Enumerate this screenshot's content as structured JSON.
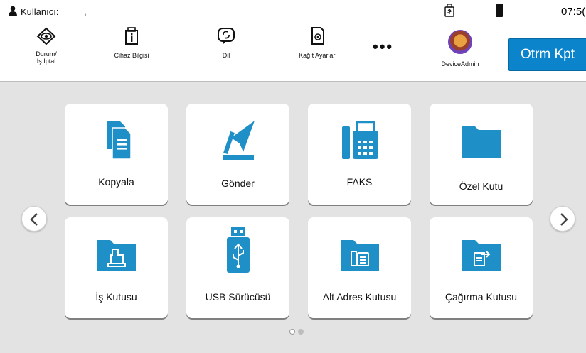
{
  "status_bar": {
    "user_label": "Kullanıcı:",
    "user_value": ",",
    "clock": "07:5("
  },
  "toolbar": {
    "status_cancel_label": "Durum/\nİş İptal",
    "device_info_label": "Cihaz Bilgisi",
    "language_label": "Dil",
    "paper_settings_label": "Kağıt Ayarları",
    "more_label": "•••",
    "account_label": "DeviceAdmin",
    "logout_label": "Otrm Kpt"
  },
  "tiles": [
    {
      "label": "Kopyala",
      "icon": "copy-icon"
    },
    {
      "label": "Gönder",
      "icon": "send-icon"
    },
    {
      "label": "FAKS",
      "icon": "fax-icon"
    },
    {
      "label": "Özel Kutu",
      "icon": "custom-box-folder-icon"
    },
    {
      "label": "İş Kutusu",
      "icon": "job-box-folder-icon"
    },
    {
      "label": "USB Sürücüsü",
      "icon": "usb-drive-icon"
    },
    {
      "label": "Alt Adres Kutusu",
      "icon": "subaddress-box-folder-icon"
    },
    {
      "label": "Çağırma Kutusu",
      "icon": "polling-box-folder-icon"
    }
  ],
  "pagination": {
    "current_page": 1,
    "total_pages": 2
  },
  "colors": {
    "accent": "#0b84cc",
    "icon_blue": "#1f8fc7",
    "background": "#e3e3e3",
    "tile": "#ffffff"
  }
}
